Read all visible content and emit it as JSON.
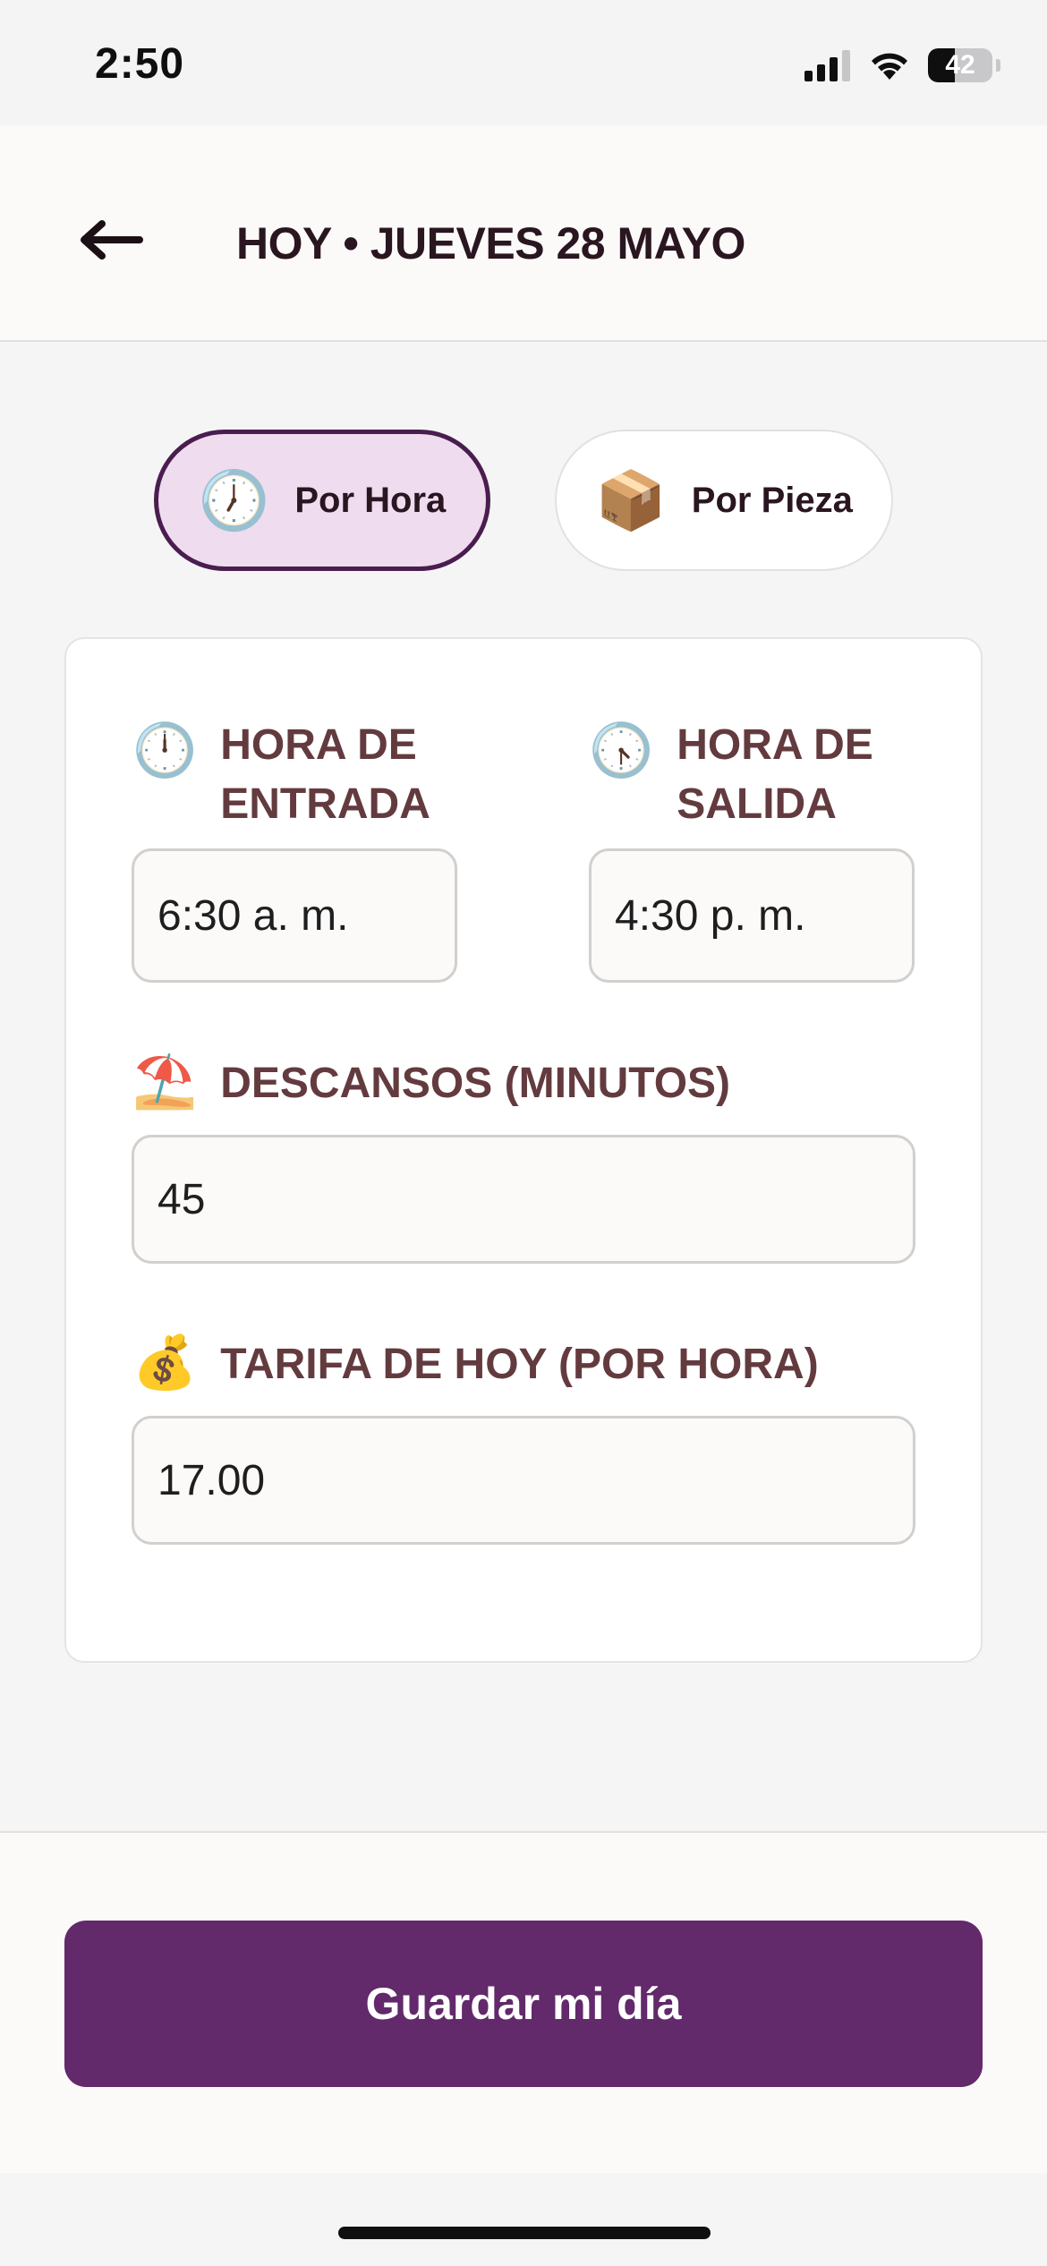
{
  "status_bar": {
    "time": "2:50",
    "battery_level": "42",
    "battery_fraction": 0.42
  },
  "header": {
    "title": "HOY • JUEVES 28 MAYO",
    "back_icon": "arrow-left-icon"
  },
  "mode_toggle": {
    "options": [
      {
        "label": "Por Hora",
        "emoji": "🕖",
        "selected": true
      },
      {
        "label": "Por Pieza",
        "emoji": "📦",
        "selected": false
      }
    ]
  },
  "form": {
    "entry_time": {
      "emoji": "🕛",
      "label_line1": "HORA DE",
      "label_line2": "ENTRADA",
      "value": "6:30 a. m."
    },
    "exit_time": {
      "emoji": "🕟",
      "label_line1": "HORA DE",
      "label_line2": "SALIDA",
      "value": "4:30 p. m."
    },
    "breaks": {
      "emoji": "⛱️",
      "label": "DESCANSOS (MINUTOS)",
      "value": "45"
    },
    "rate": {
      "emoji": "💰",
      "label": "TARIFA DE HOY (POR HORA)",
      "value": "17.00"
    }
  },
  "footer": {
    "save_label": "Guardar mi día"
  },
  "colors": {
    "accent": "#62296b",
    "toggle_active_bg": "#efdcef",
    "label": "#633b3f"
  }
}
